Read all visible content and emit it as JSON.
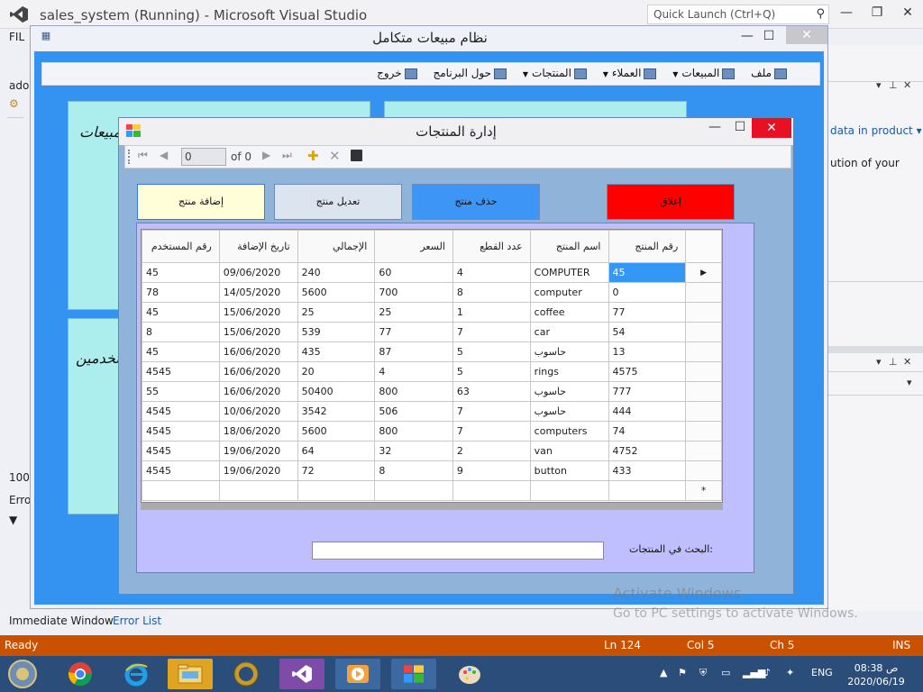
{
  "vs": {
    "title": "sales_system (Running) - Microsoft Visual Studio",
    "quick_launch_placeholder": "Quick Launch (Ctrl+Q)",
    "menu_file": "FIL",
    "left_ado": "ado",
    "left_100": "100",
    "left_err": "Erro",
    "right_link": "data in product",
    "right_text": "ution of your",
    "tab_immediate": "Immediate Window",
    "tab_error": "Error List",
    "activate_title": "Activate Windows",
    "activate_sub": "Go to PC settings to activate Windows.",
    "status": {
      "ready": "Ready",
      "ln": "Ln 124",
      "col": "Col 5",
      "ch": "Ch 5",
      "ins": "INS"
    },
    "taskbar": {
      "lang": "ENG",
      "time": "08:38 ص",
      "date": "2020/06/19"
    }
  },
  "main_window": {
    "title": "نظام مبيعات متكامل",
    "menu": [
      {
        "label": "ملف",
        "has_arrow": false
      },
      {
        "label": "المبيعات",
        "has_arrow": true
      },
      {
        "label": "العملاء",
        "has_arrow": true
      },
      {
        "label": "المنتجات",
        "has_arrow": true
      },
      {
        "label": "حول البرنامج",
        "has_arrow": false
      },
      {
        "label": "خروج",
        "has_arrow": false
      }
    ],
    "panel1_text": "مبيعات",
    "panel2_text": "مستخدمين"
  },
  "dialog": {
    "title": "إدارة المنتجات",
    "navigator": {
      "position": "0",
      "count_text": "of 0"
    },
    "buttons": {
      "close": "إغلاق",
      "delete": "حذف منتج",
      "edit": "تعديل منتج",
      "add": "إضافة منتج"
    },
    "columns": [
      "رقم المنتج",
      "اسم المنتج",
      "عدد القطع",
      "السعر",
      "الإجمالي",
      "تاريخ الإضافة",
      "رقم المستخدم"
    ],
    "rows": [
      [
        "45",
        "COMPUTER",
        "4",
        "60",
        "240",
        "09/06/2020",
        "45"
      ],
      [
        "0",
        "computer",
        "8",
        "700",
        "5600",
        "14/05/2020",
        "78"
      ],
      [
        "77",
        "coffee",
        "1",
        "25",
        "25",
        "15/06/2020",
        "45"
      ],
      [
        "54",
        "car",
        "7",
        "77",
        "539",
        "15/06/2020",
        "8"
      ],
      [
        "13",
        "حاسوب",
        "5",
        "87",
        "435",
        "16/06/2020",
        "45"
      ],
      [
        "4575",
        "rings",
        "5",
        "4",
        "20",
        "16/06/2020",
        "4545"
      ],
      [
        "777",
        "حاسوب",
        "63",
        "800",
        "50400",
        "16/06/2020",
        "55"
      ],
      [
        "444",
        "حاسوب",
        "7",
        "506",
        "3542",
        "10/06/2020",
        "4545"
      ],
      [
        "74",
        "computers",
        "7",
        "800",
        "5600",
        "18/06/2020",
        "4545"
      ],
      [
        "4752",
        "van",
        "2",
        "32",
        "64",
        "19/06/2020",
        "4545"
      ],
      [
        "433",
        "button",
        "9",
        "8",
        "72",
        "19/06/2020",
        "4545"
      ]
    ],
    "new_row_marker": "*",
    "current_row_marker": "▶",
    "search_label": "البحث في المنتجات:",
    "search_value": ""
  }
}
